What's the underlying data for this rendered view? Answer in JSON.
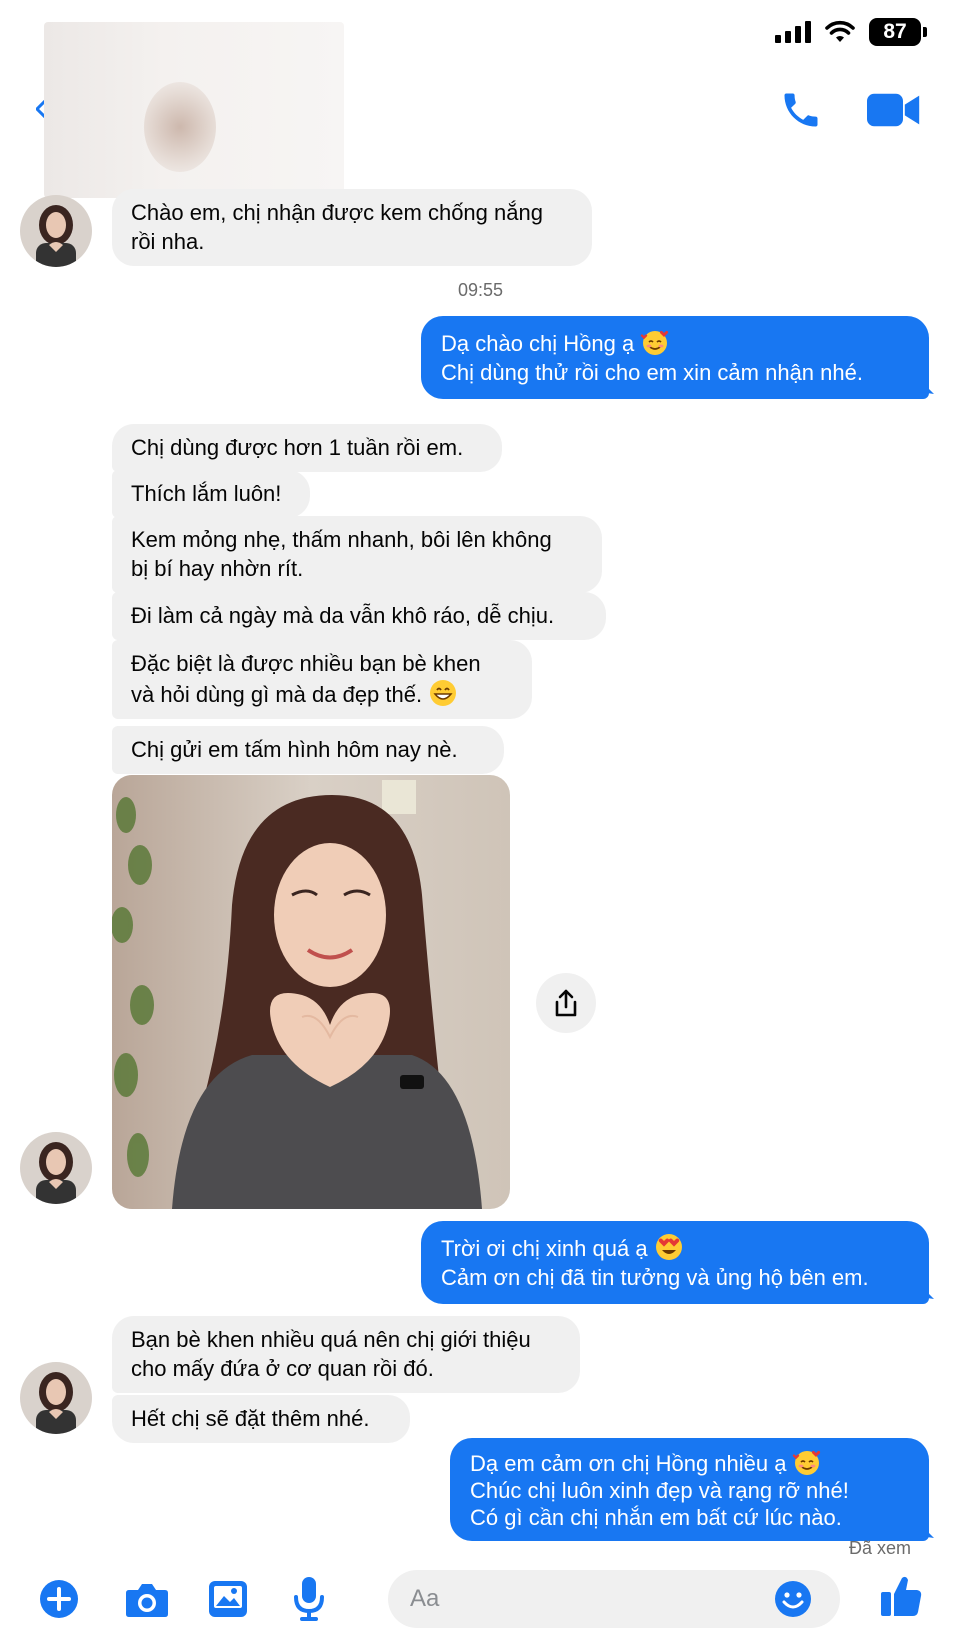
{
  "status_bar": {
    "battery": "87"
  },
  "header": {
    "contact_name": "",
    "actions": [
      "phone-icon",
      "video-call-icon"
    ]
  },
  "colors": {
    "accent": "#1877f2",
    "incoming_bubble": "#f0f0f0",
    "outgoing_text": "#ffffff"
  },
  "messages": [
    {
      "from": "them",
      "text": "Chào em, chị nhận được kem chống nắng\nrồi nha."
    },
    {
      "timestamp": "09:55"
    },
    {
      "from": "me",
      "text": "Dạ chào chị Hồng ạ",
      "emoji": "smiling-face-with-hearts",
      "text2": "Chị dùng thử rồi cho em xin cảm nhận nhé."
    },
    {
      "from": "them",
      "text": "Chị dùng được hơn 1 tuần rồi em."
    },
    {
      "from": "them",
      "text": "Thích lắm luôn!"
    },
    {
      "from": "them",
      "text": "Kem mỏng nhẹ, thấm nhanh, bôi lên không\nbị bí hay nhờn rít."
    },
    {
      "from": "them",
      "text": "Đi làm cả ngày mà da vẫn khô ráo, dễ chịu."
    },
    {
      "from": "them",
      "text": "Đặc biệt là được nhiều bạn bè khen\nvà hỏi dùng gì mà da đẹp thế.",
      "emoji": "grinning-face"
    },
    {
      "from": "them",
      "text": "Chị gửi em tấm hình hôm nay nè."
    },
    {
      "from": "them",
      "type": "photo",
      "description_icon": "photo-heart-hands"
    },
    {
      "from": "me",
      "text": "Trời ơi chị xinh quá ạ",
      "emoji": "heart-eyes",
      "text2": "Cảm ơn chị đã tin tưởng và ủng hộ bên em."
    },
    {
      "from": "them",
      "text": "Bạn bè khen nhiều quá nên chị giới thiệu\ncho mấy đứa ở cơ quan rồi đó."
    },
    {
      "from": "them",
      "text": "Hết chị sẽ đặt thêm nhé."
    },
    {
      "from": "me",
      "text": "Dạ em cảm ơn chị Hồng nhiều ạ",
      "emoji": "smiling-face-with-hearts",
      "text2": "Chúc chị luôn xinh đẹp và rạng rỡ nhé!\nCó gì cần chị nhắn em bất cứ lúc nào."
    }
  ],
  "seen_label": "Đã xem",
  "composer": {
    "placeholder": "Aa",
    "icons": [
      "plus-icon",
      "camera-icon",
      "gallery-icon",
      "microphone-icon",
      "emoji-icon",
      "like-icon"
    ]
  }
}
